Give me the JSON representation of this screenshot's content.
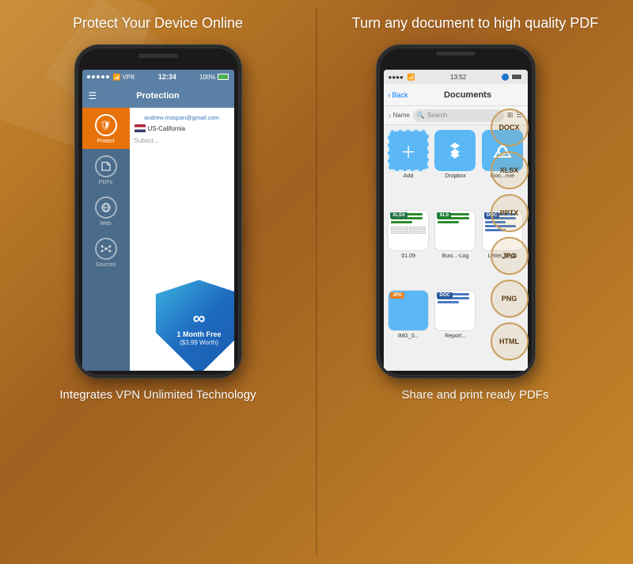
{
  "left": {
    "title": "Protect Your Device\nOnline",
    "footer": "Integrates VPN Unlimited\nTechnology",
    "phone": {
      "statusBar": {
        "dots": 5,
        "wifi": "wifi",
        "carrier": "VPK",
        "time": "12:34",
        "battery": "100%"
      },
      "navTitle": "Protection",
      "email": "andrew.mospan@gmail.com",
      "location": "US-California",
      "subscribe": "Subscr...",
      "shield": {
        "line1": "1 Month Free",
        "line2": "($3.99 Worth)"
      }
    },
    "sidebar": [
      {
        "label": "Protect",
        "active": true,
        "icon": "🛡"
      },
      {
        "label": "PDFs",
        "active": false,
        "icon": "📄"
      },
      {
        "label": "Web",
        "active": false,
        "icon": "🌐"
      },
      {
        "label": "Sources",
        "active": false,
        "icon": "⚙"
      }
    ]
  },
  "right": {
    "title": "Turn any document to\nhigh quality PDF",
    "footer": "Share and print ready PDFs",
    "phone": {
      "statusBar": {
        "time": "13:52",
        "bluetooth": true
      },
      "navTitle": "Documents",
      "backLabel": "Back",
      "toolbar": {
        "sortLabel": "Name",
        "searchPlaceholder": "Search",
        "icons": [
          "grid",
          "list"
        ]
      },
      "files": [
        {
          "name": "Add",
          "type": "add"
        },
        {
          "name": "Dropbox",
          "type": "dropbox"
        },
        {
          "name": "Goo...rive",
          "type": "gdrive"
        },
        {
          "name": "01.09",
          "type": "xlsx"
        },
        {
          "name": "Busi...-Log",
          "type": "xls"
        },
        {
          "name": "Letter_legal",
          "type": "doc"
        },
        {
          "name": "IMG_0...",
          "type": "jpg"
        },
        {
          "name": "Report...",
          "type": "doc2"
        }
      ]
    },
    "formats": [
      "DOCX",
      "XLSX",
      "PPTX",
      "JPG",
      "PNG",
      "HTML"
    ]
  }
}
